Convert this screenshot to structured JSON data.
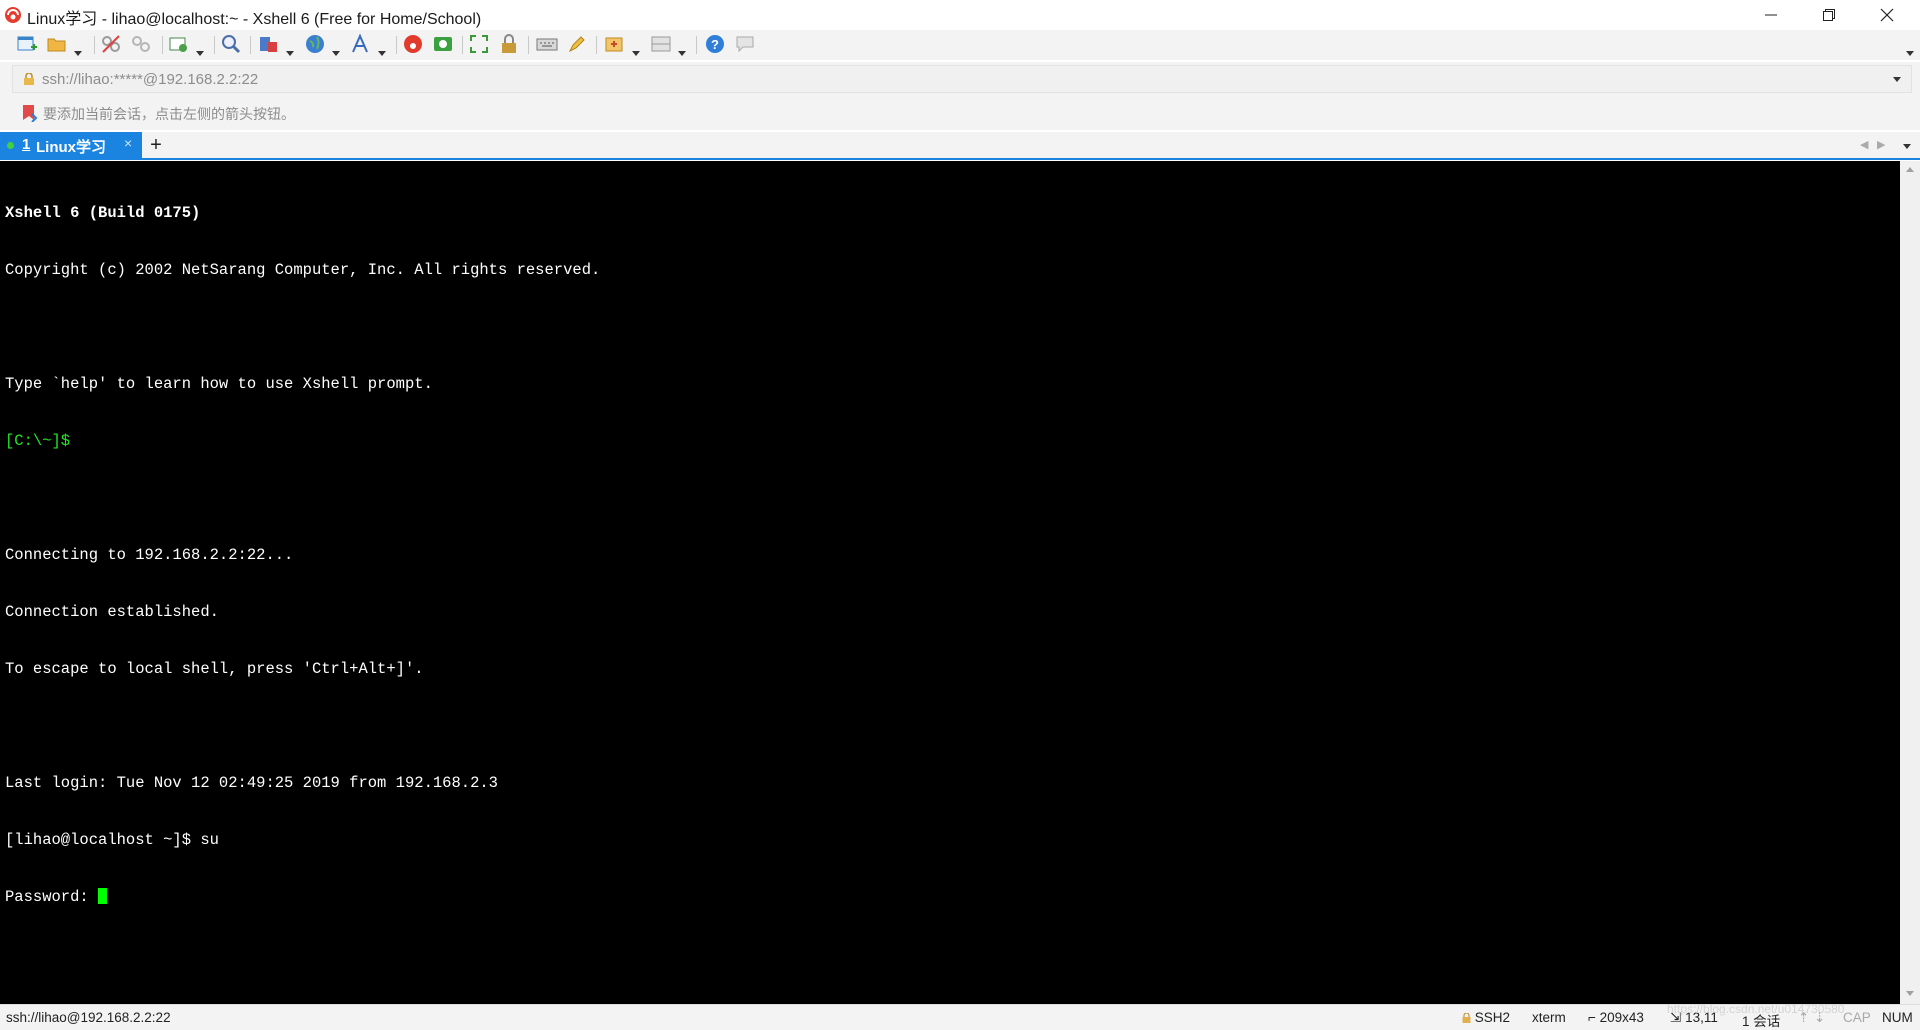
{
  "window": {
    "title": "Linux学习 - lihao@localhost:~ - Xshell 6 (Free for Home/School)",
    "icons": [
      "xshell-logo-icon",
      "minimize-icon",
      "maximize-icon",
      "close-icon"
    ]
  },
  "toolbar": {
    "icons": [
      "new-session-icon",
      "open-folder-icon",
      "connect-icon",
      "disconnect-icon",
      "properties-icon",
      "find-icon",
      "transfer-icon",
      "globe-icon",
      "font-icon",
      "xshell-icon",
      "xftp-icon",
      "fullscreen-icon",
      "lock-icon",
      "keyboard-icon",
      "highlight-icon",
      "script-icon",
      "layout-icon",
      "help-icon",
      "chat-icon"
    ]
  },
  "address": {
    "value": "ssh://lihao:*****@192.168.2.2:22"
  },
  "session_hint": {
    "text": "要添加当前会话，点击左侧的箭头按钮。"
  },
  "tabs": [
    {
      "number": "1",
      "label": "Linux学习",
      "close": "×",
      "active": true
    }
  ],
  "tab_add_label": "+",
  "terminal": {
    "lines": [
      "Xshell 6 (Build 0175)",
      "Copyright (c) 2002 NetSarang Computer, Inc. All rights reserved.",
      "",
      "Type `help' to learn how to use Xshell prompt.",
      "[C:\\~]$",
      "",
      "Connecting to 192.168.2.2:22...",
      "Connection established.",
      "To escape to local shell, press 'Ctrl+Alt+]'.",
      "",
      "Last login: Tue Nov 12 02:49:25 2019 from 192.168.2.3",
      "[lihao@localhost ~]$ su",
      "Password: "
    ],
    "colors": {
      "background": "#000000",
      "text": "#ffffff",
      "prompt": "#21e621",
      "cursor": "#00ff00"
    }
  },
  "status": {
    "connection": "ssh://lihao@192.168.2.2:22",
    "protocol": "SSH2",
    "terminal_type": "xterm",
    "size": "209x43",
    "cursor_pos": "13,11",
    "sessions": "1 会话",
    "watermark": "https://blog.csdn.net/u014730580",
    "cap": "CAP",
    "num": "NUM"
  },
  "accent_color": "#1a84e0"
}
